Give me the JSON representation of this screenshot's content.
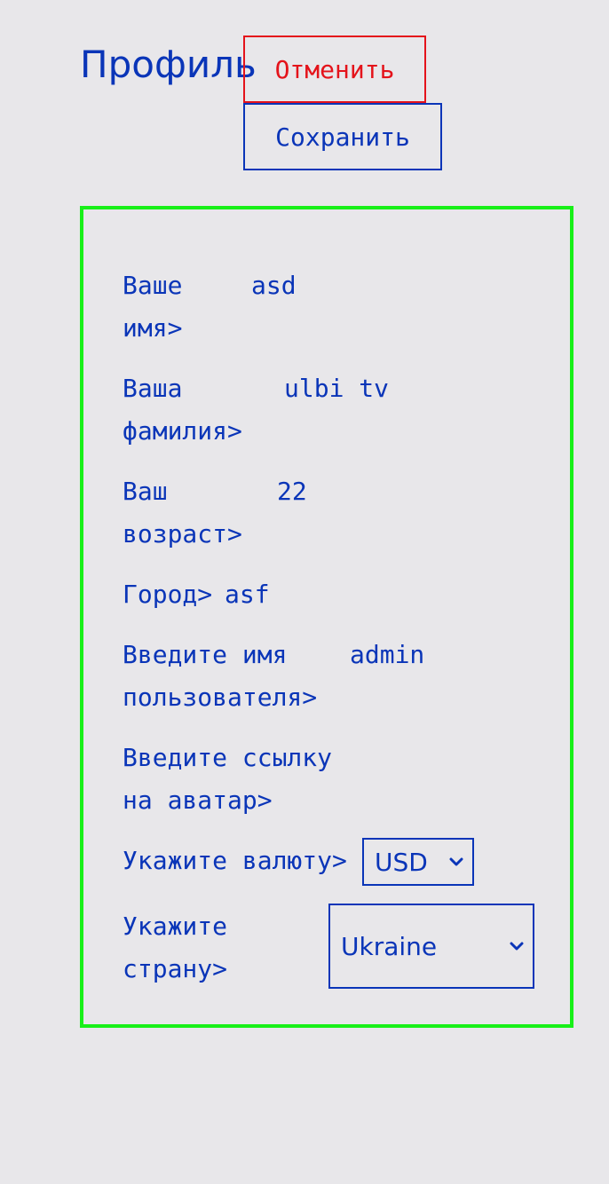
{
  "header": {
    "title": "Профиль",
    "cancel_label": "Отменить",
    "save_label": "Сохранить"
  },
  "form": {
    "first_name": {
      "label_line1": "Ваше",
      "label_line2": "имя>",
      "value": "asd"
    },
    "last_name": {
      "label_line1": "Ваша",
      "label_line2": "фамилия>",
      "value": "ulbi tv"
    },
    "age": {
      "label_line1": "Ваш",
      "label_line2": "возраст>",
      "value": "22"
    },
    "city": {
      "label": "Город>",
      "value": "asf"
    },
    "username": {
      "label_line1": "Введите имя",
      "label_line2": "пользователя>",
      "value": "admin"
    },
    "avatar": {
      "label_line1": "Введите ссылку",
      "label_line2": "на аватар>",
      "value": ""
    },
    "currency": {
      "label": "Укажите валюту>",
      "selected": "USD"
    },
    "country": {
      "label_line1": "Укажите",
      "label_line2": "страну>",
      "selected": "Ukraine"
    }
  },
  "colors": {
    "text": "#0a35b8",
    "cancel": "#e4131b",
    "card_border": "#18f018",
    "background": "#e8e7ea"
  }
}
